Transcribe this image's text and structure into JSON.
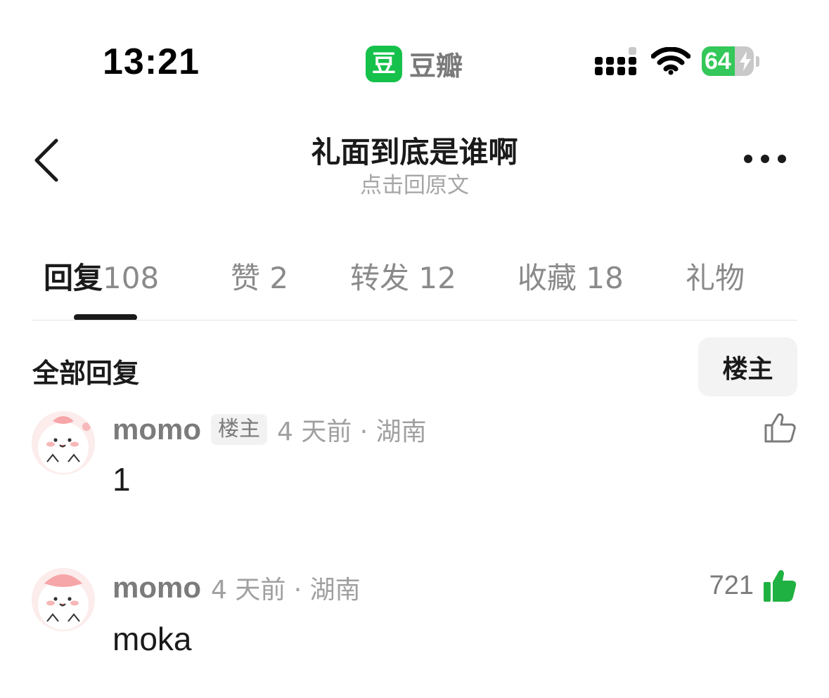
{
  "status_bar": {
    "time": "13:21",
    "app_icon_char": "豆",
    "app_name": "豆瓣",
    "battery_level": 64,
    "battery_text": "64",
    "icons": [
      "signal-icon",
      "wifi-icon",
      "battery-icon",
      "charging-bolt-icon"
    ]
  },
  "nav": {
    "title": "礼面到底是谁啊",
    "subtitle": "点击回原文",
    "icons": [
      "chevron-left-icon",
      "more-dots-icon"
    ]
  },
  "tabs": [
    {
      "label": "回复",
      "count": "108"
    },
    {
      "label": "赞",
      "count": "2"
    },
    {
      "label": "转发",
      "count": "12"
    },
    {
      "label": "收藏",
      "count": "18"
    },
    {
      "label": "礼物",
      "count": ""
    }
  ],
  "filter": {
    "section_title": "全部回复",
    "op_filter_label": "楼主"
  },
  "comments": [
    {
      "author": "momo",
      "badge": "楼主",
      "time_location": "4 天前 · 湖南",
      "text": "1",
      "likes": "",
      "liked": false
    },
    {
      "author": "momo",
      "badge": "",
      "time_location": "4 天前 · 湖南",
      "text": "moka",
      "likes": "721",
      "liked": true
    }
  ],
  "colors": {
    "brand_green": "#16c14b",
    "like_green": "#1fb141",
    "battery_green": "#34c759",
    "text_primary": "#1a1a1a",
    "text_secondary": "#8a8a8a"
  }
}
